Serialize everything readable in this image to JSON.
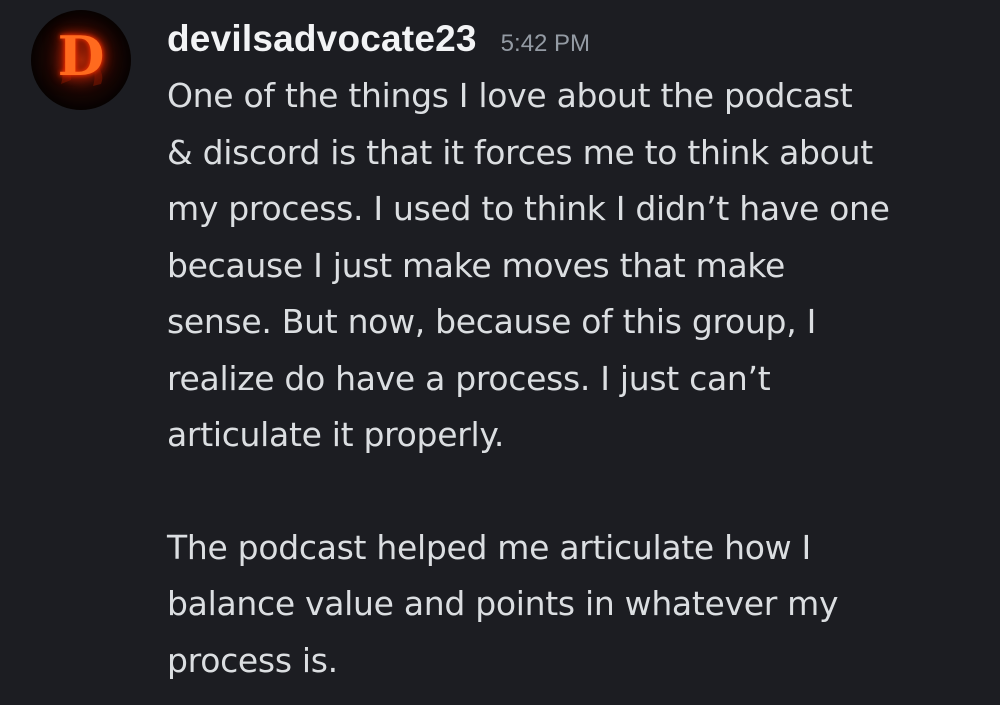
{
  "message": {
    "avatar_letter": "D",
    "username": "devilsadvocate23",
    "timestamp": "5:42 PM",
    "paragraphs": [
      {
        "lines": [
          "One of the things I love about the podcast",
          "& discord is that it forces me to think about",
          "my process. I used to think I didn’t have one",
          "because I just make moves that make",
          "sense. But now, because of this group, I",
          "realize do have a process. I just can’t",
          "articulate it properly."
        ]
      },
      {
        "lines": [
          "The podcast helped me articulate how I",
          "balance value and points in whatever my",
          "process is."
        ]
      }
    ]
  },
  "colors": {
    "background": "#1c1d22",
    "username": "#f2f3f5",
    "timestamp": "#949ba4",
    "body_text": "#dbdee1",
    "avatar_accent": "#ff6a1e"
  },
  "icons": {
    "avatar": "flaming-d-avatar-icon"
  }
}
